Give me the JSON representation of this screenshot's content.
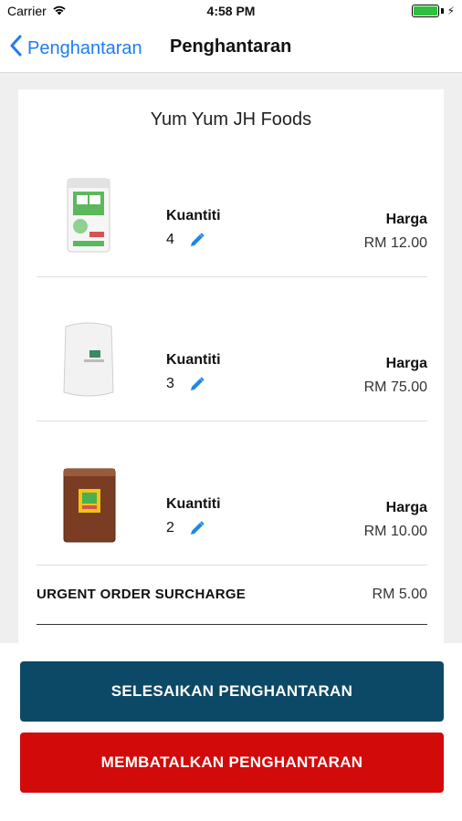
{
  "status_bar": {
    "carrier": "Carrier",
    "time": "4:58 PM",
    "battery_level": 1.0,
    "battery_color": "#2fbf3f"
  },
  "nav": {
    "back_label": "Penghantaran",
    "title": "Penghantaran",
    "accent_color": "#1e7cf2"
  },
  "order": {
    "shop_name": "Yum Yum JH Foods",
    "items": [
      {
        "image": "white-green-package",
        "qty_label": "Kuantiti",
        "qty": "4",
        "price_label": "Harga",
        "price": "RM 12.00"
      },
      {
        "image": "white-sack",
        "qty_label": "Kuantiti",
        "qty": "3",
        "price_label": "Harga",
        "price": "RM 75.00"
      },
      {
        "image": "brown-package",
        "qty_label": "Kuantiti",
        "qty": "2",
        "price_label": "Harga",
        "price": "RM 10.00"
      }
    ],
    "surcharge_label": "URGENT ORDER SURCHARGE",
    "surcharge_value": "RM 5.00"
  },
  "actions": {
    "complete_label": "SELESAIKAN PENGHANTARAN",
    "complete_color": "#0c4966",
    "cancel_label": "MEMBATALKAN PENGHANTARAN",
    "cancel_color": "#d20a0a"
  }
}
